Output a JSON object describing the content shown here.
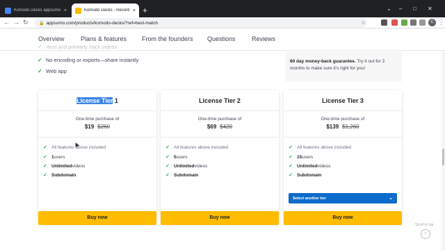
{
  "browser": {
    "tabs": [
      {
        "title": "Komodo Decks appsumo review",
        "close": "×"
      },
      {
        "title": "Komodo Decks - Record your sc",
        "close": "×"
      }
    ],
    "new_tab": "+",
    "url": "appsumo.com/products/komodo-decks/?ref=best-match",
    "profile_initial": "C",
    "window_controls": {
      "minimize": "⌄",
      "maximize": "–",
      "restore": "□",
      "close": "✕"
    }
  },
  "nav": {
    "links": [
      "Overview",
      "Plans & features",
      "From the founders",
      "Questions",
      "Reviews"
    ]
  },
  "features_top": [
    "Host and privately track videos",
    "No encoding or exports—share instantly",
    "Web app"
  ],
  "guarantee": {
    "bold": "60 day money-back guarantee.",
    "rest": " Try it out for 2 months to make sure it's right for you!"
  },
  "tiers": [
    {
      "title_selected": "License Tier",
      "title_rest": " 1",
      "one_time": "One-time purchase of",
      "price": "$19",
      "original_price": "$260",
      "features": [
        {
          "bold": "",
          "text": "All features above included"
        },
        {
          "bold": "1",
          "text": " users"
        },
        {
          "bold": "Unlimited",
          "text": " videos"
        },
        {
          "bold": "Subdomain",
          "text": ""
        }
      ],
      "buy": "Buy now"
    },
    {
      "title": "License Tier 2",
      "one_time": "One-time purchase of",
      "price": "$69",
      "original_price": "$420",
      "features": [
        {
          "bold": "",
          "text": "All features above included"
        },
        {
          "bold": "5",
          "text": " users"
        },
        {
          "bold": "Unlimited",
          "text": " videos"
        },
        {
          "bold": "Subdomain",
          "text": ""
        }
      ],
      "buy": "Buy now"
    },
    {
      "title": "License Tier 3",
      "one_time": "One-time purchase of",
      "price": "$139",
      "original_price": "$1,260",
      "features": [
        {
          "bold": "",
          "text": "All features above included"
        },
        {
          "bold": "15",
          "text": " users"
        },
        {
          "bold": "Unlimited",
          "text": " videos"
        },
        {
          "bold": "Subdomain",
          "text": ""
        }
      ],
      "select_label": "Select another tier",
      "buy": "Buy now"
    }
  ],
  "scroll_to_top": {
    "label": "Scroll to top",
    "icon": "↑"
  },
  "colors": {
    "buy_button": "#ffbc00",
    "select_button": "#0d6bcb",
    "check": "#28a745"
  }
}
